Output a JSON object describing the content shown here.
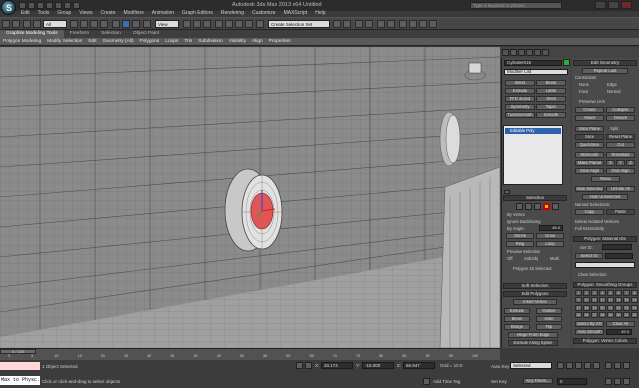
{
  "window": {
    "title": "Autodesk 3ds Max 2013 x64  Untitled",
    "search_placeholder": "Type a keyword or phrase",
    "logo_letter": "S"
  },
  "menubar": [
    "Edit",
    "Tools",
    "Group",
    "Views",
    "Create",
    "Modifiers",
    "Animation",
    "Graph Editors",
    "Rendering",
    "Customize",
    "MAXScript",
    "Help"
  ],
  "toolbar": {
    "selection_filter": "All",
    "coord_system": "View",
    "named_selection": "Create Selection Set"
  },
  "ribbon": {
    "tabs": [
      "Graphite Modeling Tools",
      "Freeform",
      "Selection",
      "Object Paint"
    ],
    "active_tab": 0,
    "panels": [
      "Polygon Modeling",
      "Modify Selection",
      "Edit",
      "Geometry (All)",
      "Polygons",
      "Loops",
      "Tris",
      "Subdivision",
      "Visibility",
      "Align",
      "Properties"
    ]
  },
  "command_panel": {
    "object_name": "Cylinder016",
    "modifier_list": "Modifier List",
    "buttons": [
      [
        "Bend",
        "Bevel"
      ],
      [
        "Extrude",
        "Lathe"
      ],
      [
        "FFD 3x3x3",
        "Shell"
      ],
      [
        "Symmetry",
        "Taper"
      ],
      [
        "TurboSmooth",
        "Smooth"
      ]
    ],
    "stack_item": "Editable Poly",
    "selection_title": "Selection",
    "by_vertex": "By Vertex",
    "ignore_backfacing": "Ignore Backfacing",
    "by_angle": "By Angle:",
    "by_angle_value": "45.0",
    "shrink": "Shrink",
    "grow": "Grow",
    "ring": "Ring",
    "loop": "Loop",
    "preview_selection": "Preview Selection",
    "off": "Off",
    "subobj": "SubObj",
    "multi": "Multi",
    "status": "Polygon 16 Selected",
    "soft_selection": "Soft Selection",
    "edit_polygons": "Edit Polygons",
    "insert_vertex": "Insert Vertex",
    "extrude": "Extrude",
    "outline": "Outline",
    "bevel": "Bevel",
    "inset": "Inset",
    "bridge": "Bridge",
    "flip": "Flip",
    "hinge": "Hinge From Edge",
    "extrude_spline": "Extrude Along Spline",
    "edit_triangulation": "Edit Triangulation",
    "retriangulate": "Retriangulate",
    "turn": "Turn"
  },
  "rollout": {
    "edit_geometry": "Edit Geometry",
    "repeat_last": "Repeat Last",
    "constraints": "Constraints",
    "c_none": "None",
    "c_edge": "Edge",
    "c_face": "Face",
    "c_normal": "Normal",
    "preserve_uvs": "Preserve UVs",
    "create": "Create",
    "collapse": "Collapse",
    "attach": "Attach",
    "detach": "Detach",
    "slice_plane": "Slice Plane",
    "split": "Split",
    "slice": "Slice",
    "reset_plane": "Reset Plane",
    "quickslice": "QuickSlice",
    "cut": "Cut",
    "msmooth": "MSmooth",
    "tessellate": "Tessellate",
    "make_planar": "Make Planar",
    "x": "X",
    "y": "Y",
    "z": "Z",
    "view_align": "View Align",
    "grid_align": "Grid Align",
    "relax": "Relax",
    "hide_selected": "Hide Selected",
    "unhide_all": "Unhide All",
    "hide_unselected": "Hide Unselected",
    "named_selections": "Named Selections:",
    "copy": "Copy",
    "paste": "Paste",
    "delete_isolated": "Delete Isolated Vertices",
    "full_interactivity": "Full Interactivity",
    "material_ids": "Polygon: Material IDs",
    "set_id": "Set ID:",
    "select_id": "Select ID",
    "clear_selection": "Clear Selection",
    "smoothing_groups": "Polygon: Smoothing Groups",
    "groups": [
      "1",
      "2",
      "3",
      "4",
      "5",
      "6",
      "7",
      "8",
      "9",
      "10",
      "11",
      "12",
      "13",
      "14",
      "15",
      "16",
      "17",
      "18",
      "19",
      "20",
      "21",
      "22",
      "23",
      "24",
      "25",
      "26",
      "27",
      "28",
      "29",
      "30",
      "31",
      "32"
    ],
    "select_by_sg": "Select By SG",
    "clear_all": "Clear All",
    "auto_smooth": "Auto Smooth",
    "auto_smooth_value": "45.0",
    "vertex_colors": "Polygon: Vertex Colors",
    "color": "Color:"
  },
  "timeline": {
    "frame_label": "0 / 100",
    "ticks": [
      "0",
      "5",
      "10",
      "15",
      "20",
      "25",
      "30",
      "35",
      "40",
      "45",
      "50",
      "55",
      "60",
      "65",
      "70",
      "75",
      "80",
      "85",
      "90",
      "95",
      "100"
    ]
  },
  "status": {
    "maxscript": "Max to Physc.",
    "objects_selected": "1 Object Selected",
    "prompt": "Click or click-and-drag to select objects",
    "x_label": "X:",
    "x_value": "20.174",
    "y_label": "Y:",
    "y_value": "-15.000",
    "z_label": "Z:",
    "z_value": "66.947",
    "grid": "Grid = 10.0",
    "add_time_tag": "Add Time Tag",
    "auto_key": "Auto Key",
    "selected": "Selected",
    "set_key": "Set Key",
    "key_filters": "Key Filters...",
    "frame": "0"
  },
  "colors": {
    "accent": "#2f62ad",
    "viewport_bg": "#8c8c8c",
    "selection_red": "#e05555",
    "wall": "#bfbfbf"
  }
}
